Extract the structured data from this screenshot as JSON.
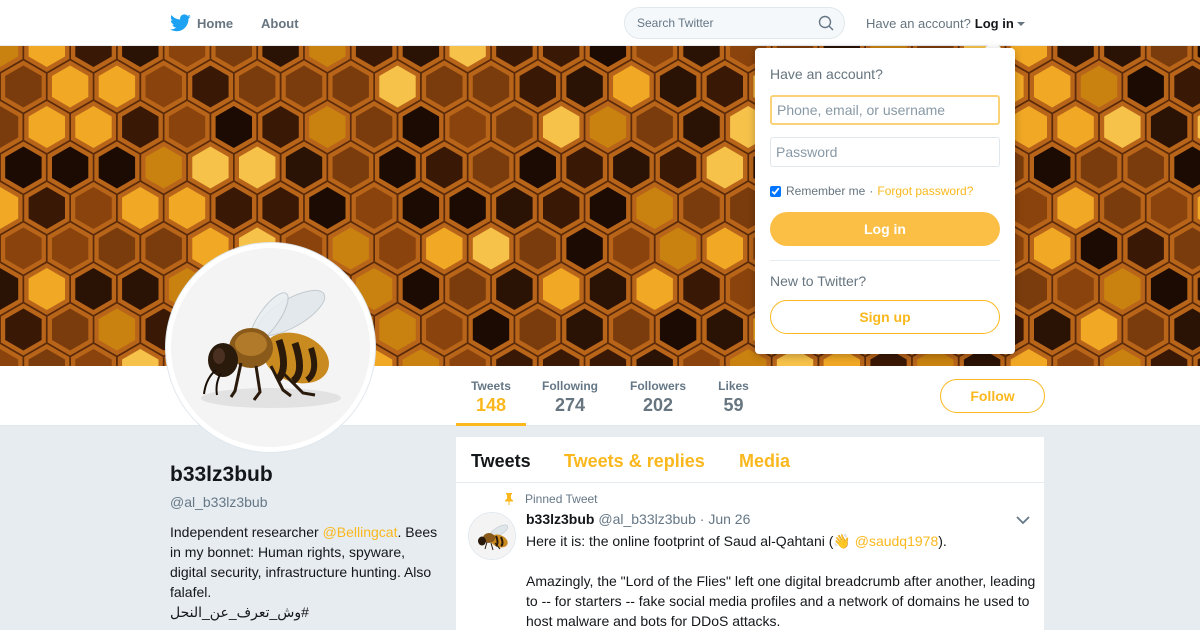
{
  "nav": {
    "home_label": "Home",
    "about_label": "About",
    "search_placeholder": "Search Twitter",
    "have_account": "Have an account?",
    "login_label": "Log in"
  },
  "profile": {
    "name": "b33lz3bub",
    "handle": "@al_b33lz3bub",
    "bio_prefix": "Independent researcher ",
    "bio_mention": "@Bellingcat",
    "bio_rest": ". Bees in my bonnet: Human rights, spyware, digital security, infrastructure hunting. Also falafel.",
    "bio_hashtag": "#وش_تعرف_عن_النحل"
  },
  "stats": [
    {
      "label": "Tweets",
      "value": "148"
    },
    {
      "label": "Following",
      "value": "274"
    },
    {
      "label": "Followers",
      "value": "202"
    },
    {
      "label": "Likes",
      "value": "59"
    }
  ],
  "follow_label": "Follow",
  "tabs": [
    "Tweets",
    "Tweets & replies",
    "Media"
  ],
  "tweet": {
    "pinned_label": "Pinned Tweet",
    "name": "b33lz3bub",
    "handle": "@al_b33lz3bub",
    "date": "· Jun 26",
    "line1_prefix": "Here it is: the online footprint of Saud al-Qahtani (",
    "line1_emoji": "👋",
    "line1_mention": "@saudq1978",
    "line1_suffix": ").",
    "paragraph2": "Amazingly, the \"Lord of the Flies\" left one digital breadcrumb after another, leading to -- for starters -- fake social media profiles and a network of domains he used to host malware and bots for DDoS attacks."
  },
  "login_dropdown": {
    "title": "Have an account?",
    "user_placeholder": "Phone, email, or username",
    "password_placeholder": "Password",
    "remember_label": "Remember me",
    "separator": "·",
    "forgot_label": "Forgot password?",
    "login_button": "Log in",
    "new_label": "New to Twitter?",
    "signup_button": "Sign up"
  },
  "colors": {
    "accent": "#fab81e",
    "text": "#14171a",
    "muted": "#657786",
    "background": "#e6ecf0"
  }
}
